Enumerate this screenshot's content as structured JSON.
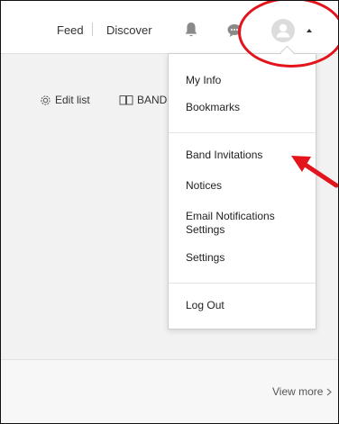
{
  "header": {
    "nav": [
      {
        "label": "Feed"
      },
      {
        "label": "Discover"
      }
    ],
    "icons": {
      "bell": "bell-icon",
      "chat": "chat-icon",
      "avatar": "avatar",
      "caret": "caret-up-icon"
    }
  },
  "toolbar": {
    "edit_list_label": "Edit list",
    "band_label": "BAND"
  },
  "menu": {
    "items": [
      {
        "label": "My Info"
      },
      {
        "label": "Bookmarks"
      },
      {
        "label": "Band Invitations"
      },
      {
        "label": "Notices"
      },
      {
        "label": "Email Notifications Settings"
      },
      {
        "label": "Settings"
      },
      {
        "label": "Log Out"
      }
    ]
  },
  "footer": {
    "view_more_label": "View more"
  },
  "colors": {
    "annotation_red": "#e3141b",
    "text": "#333333",
    "icon_gray": "#8a8a8a"
  }
}
